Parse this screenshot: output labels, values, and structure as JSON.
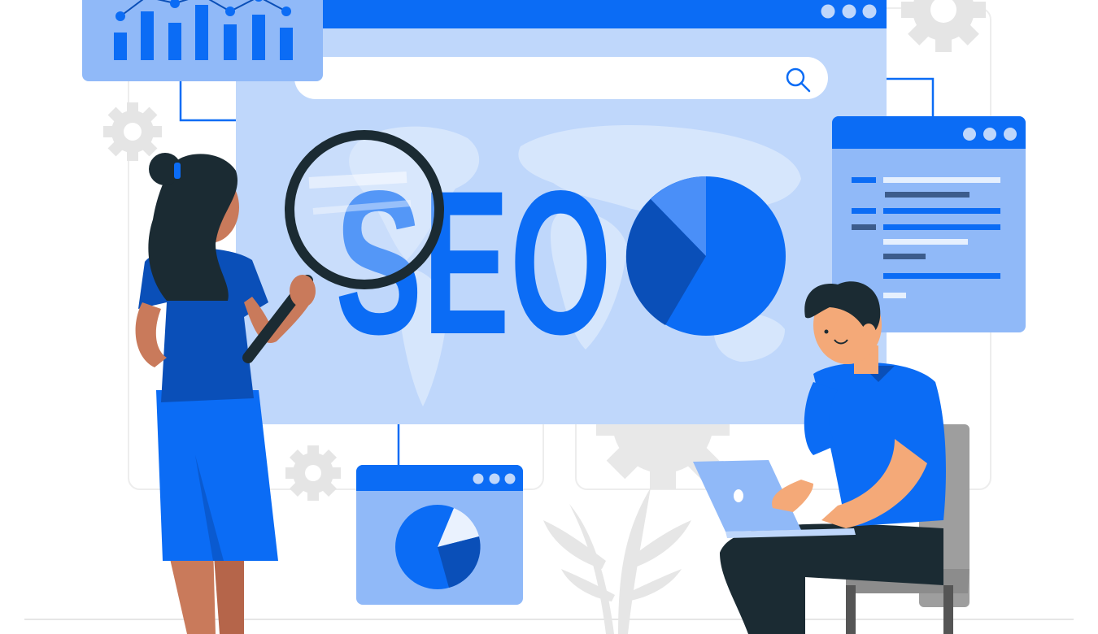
{
  "illustration": {
    "headline": "SEO",
    "colors": {
      "primary_blue": "#0B6CF5",
      "dark_blue": "#0A4FB8",
      "light_blue": "#BFD7FB",
      "mid_blue": "#90B9F8",
      "pale_gray": "#EBEBEB",
      "skin": "#C97A5B",
      "skin_light": "#F4A978",
      "hair": "#1B2B33"
    },
    "icons": {
      "search": "search-icon",
      "window_dots": "window-dots-icon",
      "gear": "gear-icon",
      "bar_chart": "bar-chart-icon",
      "pie_chart": "pie-chart-icon",
      "laptop": "laptop-icon"
    }
  }
}
